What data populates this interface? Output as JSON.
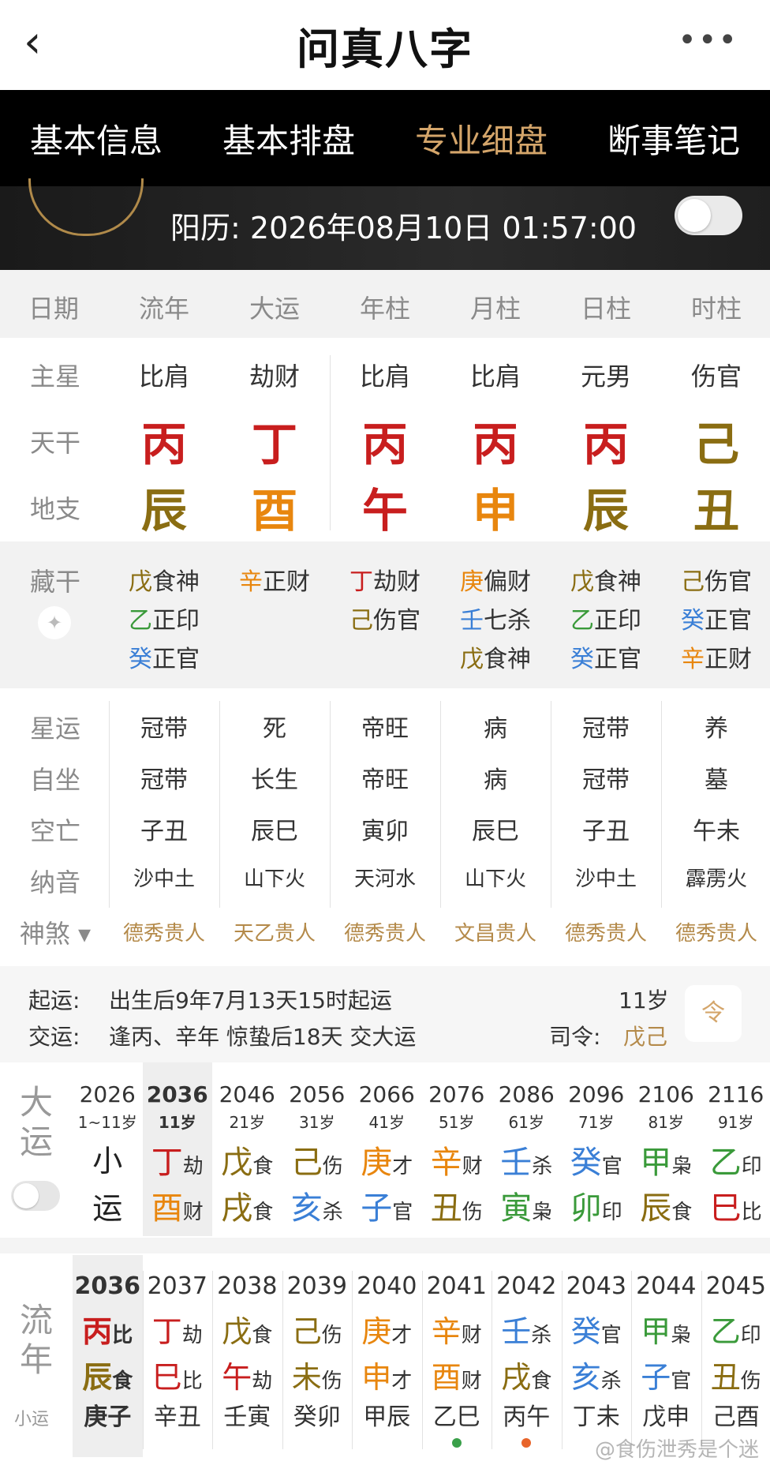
{
  "header": {
    "back": "‹",
    "title": "问真八字",
    "more": "•••"
  },
  "tabs": [
    "基本信息",
    "基本排盘",
    "专业细盘",
    "断事笔记"
  ],
  "solar": {
    "label": "阳历: ",
    "value": "2026年08月10日 01:57:00"
  },
  "columns": [
    "日期",
    "流年",
    "大运",
    "年柱",
    "月柱",
    "日柱",
    "时柱"
  ],
  "rows": {
    "zhuxing": {
      "label": "主星",
      "values": [
        "比肩",
        "劫财",
        "比肩",
        "比肩",
        "元男",
        "伤官"
      ]
    },
    "tiangan": {
      "label": "天干",
      "values": [
        "丙",
        "丁",
        "丙",
        "丙",
        "丙",
        "己"
      ],
      "colors": [
        "#c81e1e",
        "#c81e1e",
        "#c81e1e",
        "#c81e1e",
        "#c81e1e",
        "#8a6d12"
      ]
    },
    "dizhi": {
      "label": "地支",
      "values": [
        "辰",
        "酉",
        "午",
        "申",
        "辰",
        "丑"
      ],
      "colors": [
        "#8a6d12",
        "#e8860e",
        "#c81e1e",
        "#e8860e",
        "#8a6d12",
        "#8a6d12"
      ]
    }
  },
  "canggan": {
    "label": "藏干",
    "cols": [
      [
        {
          "g": "戊",
          "c": "#8a6d12",
          "t": "食神"
        },
        {
          "g": "乙",
          "c": "#3a9a3a",
          "t": "正印"
        },
        {
          "g": "癸",
          "c": "#3a7fd6",
          "t": "正官"
        }
      ],
      [
        {
          "g": "辛",
          "c": "#e8860e",
          "t": "正财"
        }
      ],
      [
        {
          "g": "丁",
          "c": "#c81e1e",
          "t": "劫财"
        },
        {
          "g": "己",
          "c": "#8a6d12",
          "t": "伤官"
        }
      ],
      [
        {
          "g": "庚",
          "c": "#e8860e",
          "t": "偏财"
        },
        {
          "g": "壬",
          "c": "#3a7fd6",
          "t": "七杀"
        },
        {
          "g": "戊",
          "c": "#8a6d12",
          "t": "食神"
        }
      ],
      [
        {
          "g": "戊",
          "c": "#8a6d12",
          "t": "食神"
        },
        {
          "g": "乙",
          "c": "#3a9a3a",
          "t": "正印"
        },
        {
          "g": "癸",
          "c": "#3a7fd6",
          "t": "正官"
        }
      ],
      [
        {
          "g": "己",
          "c": "#8a6d12",
          "t": "伤官"
        },
        {
          "g": "癸",
          "c": "#3a7fd6",
          "t": "正官"
        },
        {
          "g": "辛",
          "c": "#e8860e",
          "t": "正财"
        }
      ]
    ]
  },
  "info": [
    {
      "label": "星运",
      "values": [
        "冠带",
        "死",
        "帝旺",
        "病",
        "冠带",
        "养"
      ]
    },
    {
      "label": "自坐",
      "values": [
        "冠带",
        "长生",
        "帝旺",
        "病",
        "冠带",
        "墓"
      ]
    },
    {
      "label": "空亡",
      "values": [
        "子丑",
        "辰巳",
        "寅卯",
        "辰巳",
        "子丑",
        "午未"
      ]
    },
    {
      "label": "纳音",
      "values": [
        "沙中土",
        "山下火",
        "天河水",
        "山下火",
        "沙中土",
        "霹雳火"
      ]
    }
  ],
  "shensha": {
    "label": "神煞",
    "values": [
      "德秀贵人",
      "天乙贵人",
      "德秀贵人",
      "文昌贵人",
      "德秀贵人",
      "德秀贵人"
    ]
  },
  "qiyun": {
    "label1": "起运:",
    "text1": "出生后9年7月13天15时起运",
    "age": "11岁",
    "label2": "交运:",
    "text2": "逢丙、辛年 惊蛰后18天 交大运",
    "siling_label": "司令:",
    "siling": "戊己",
    "icon_char": "令"
  },
  "dayun": {
    "label": "大运",
    "items": [
      {
        "year": "2026",
        "age": "1~11岁",
        "g": "小",
        "gt": "",
        "z": "运",
        "zt": "",
        "gc": "#222",
        "zc": "#222"
      },
      {
        "year": "2036",
        "age": "11岁",
        "g": "丁",
        "gt": "劫",
        "z": "酉",
        "zt": "财",
        "gc": "#c81e1e",
        "zc": "#e8860e"
      },
      {
        "year": "2046",
        "age": "21岁",
        "g": "戊",
        "gt": "食",
        "z": "戌",
        "zt": "食",
        "gc": "#8a6d12",
        "zc": "#8a6d12"
      },
      {
        "year": "2056",
        "age": "31岁",
        "g": "己",
        "gt": "伤",
        "z": "亥",
        "zt": "杀",
        "gc": "#8a6d12",
        "zc": "#3a7fd6"
      },
      {
        "year": "2066",
        "age": "41岁",
        "g": "庚",
        "gt": "才",
        "z": "子",
        "zt": "官",
        "gc": "#e8860e",
        "zc": "#3a7fd6"
      },
      {
        "year": "2076",
        "age": "51岁",
        "g": "辛",
        "gt": "财",
        "z": "丑",
        "zt": "伤",
        "gc": "#e8860e",
        "zc": "#8a6d12"
      },
      {
        "year": "2086",
        "age": "61岁",
        "g": "壬",
        "gt": "杀",
        "z": "寅",
        "zt": "枭",
        "gc": "#3a7fd6",
        "zc": "#3a9a3a"
      },
      {
        "year": "2096",
        "age": "71岁",
        "g": "癸",
        "gt": "官",
        "z": "卯",
        "zt": "印",
        "gc": "#3a7fd6",
        "zc": "#3a9a3a"
      },
      {
        "year": "2106",
        "age": "81岁",
        "g": "甲",
        "gt": "枭",
        "z": "辰",
        "zt": "食",
        "gc": "#3a9a3a",
        "zc": "#8a6d12"
      },
      {
        "year": "2116",
        "age": "91岁",
        "g": "乙",
        "gt": "印",
        "z": "巳",
        "zt": "比",
        "gc": "#3a9a3a",
        "zc": "#c81e1e"
      }
    ]
  },
  "liunian": {
    "label": "流年",
    "sublabel": "小运",
    "items": [
      {
        "year": "2036",
        "g": "丙",
        "gt": "比",
        "z": "辰",
        "zt": "食",
        "gc": "#c81e1e",
        "zc": "#8a6d12",
        "xy": "庚子"
      },
      {
        "year": "2037",
        "g": "丁",
        "gt": "劫",
        "z": "巳",
        "zt": "比",
        "gc": "#c81e1e",
        "zc": "#c81e1e",
        "xy": "辛丑"
      },
      {
        "year": "2038",
        "g": "戊",
        "gt": "食",
        "z": "午",
        "zt": "劫",
        "gc": "#8a6d12",
        "zc": "#c81e1e",
        "xy": "壬寅"
      },
      {
        "year": "2039",
        "g": "己",
        "gt": "伤",
        "z": "未",
        "zt": "伤",
        "gc": "#8a6d12",
        "zc": "#8a6d12",
        "xy": "癸卯"
      },
      {
        "year": "2040",
        "g": "庚",
        "gt": "才",
        "z": "申",
        "zt": "才",
        "gc": "#e8860e",
        "zc": "#e8860e",
        "xy": "甲辰"
      },
      {
        "year": "2041",
        "g": "辛",
        "gt": "财",
        "z": "酉",
        "zt": "财",
        "gc": "#e8860e",
        "zc": "#e8860e",
        "xy": "乙巳"
      },
      {
        "year": "2042",
        "g": "壬",
        "gt": "杀",
        "z": "戌",
        "zt": "食",
        "gc": "#3a7fd6",
        "zc": "#8a6d12",
        "xy": "丙午"
      },
      {
        "year": "2043",
        "g": "癸",
        "gt": "官",
        "z": "亥",
        "zt": "杀",
        "gc": "#3a7fd6",
        "zc": "#3a7fd6",
        "xy": "丁未"
      },
      {
        "year": "2044",
        "g": "甲",
        "gt": "枭",
        "z": "子",
        "zt": "官",
        "gc": "#3a9a3a",
        "zc": "#3a7fd6",
        "xy": "戊申"
      },
      {
        "year": "2045",
        "g": "乙",
        "gt": "印",
        "z": "丑",
        "zt": "伤",
        "gc": "#3a9a3a",
        "zc": "#8a6d12",
        "xy": "己酉"
      }
    ]
  },
  "watermark": "@食伤泄秀是个迷"
}
